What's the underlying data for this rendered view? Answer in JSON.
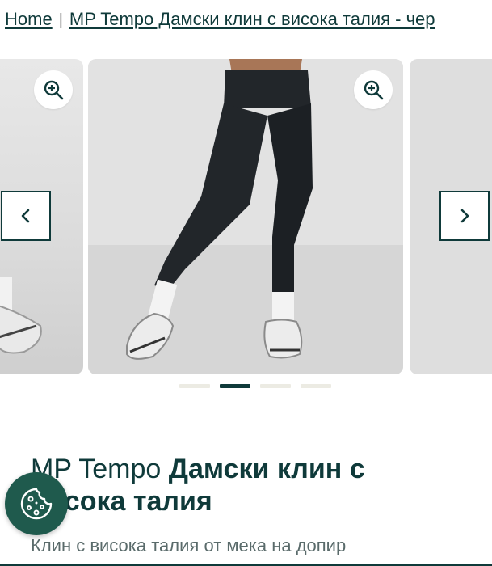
{
  "breadcrumb": {
    "home": "Home",
    "separator": "|",
    "current": "MP Tempo Дамски клин с висока талия - чер"
  },
  "gallery": {
    "active_index": 1,
    "slide_count": 4,
    "prev_icon": "chevron-left-icon",
    "next_icon": "chevron-right-icon",
    "zoom_icon": "zoom-in-icon"
  },
  "product": {
    "brand": "MP Tempo",
    "name": "Дамски клин с висока талия",
    "title_line1_brand": "MP Tempo ",
    "title_line1_name": "Дамски клин с",
    "title_line2": "висока талия",
    "subtitle": "Клин с висока талия от мека на допир"
  },
  "cookie": {
    "icon": "cookie-icon"
  },
  "colors": {
    "brand_dark": "#0f3a3a",
    "cookie_bg": "#1f5a4d",
    "dot_inactive": "#ecebe3",
    "image_bg": "#dcdcdc"
  }
}
